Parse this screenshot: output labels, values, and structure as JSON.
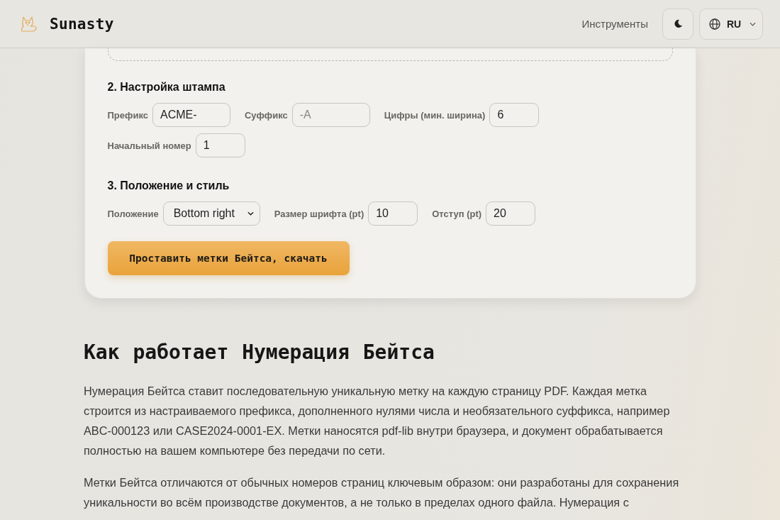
{
  "header": {
    "logo_text": "Sunasty",
    "nav_link": "Инструменты",
    "language": "RU"
  },
  "card": {
    "sections": [
      {
        "title": "2. Настройка штампа",
        "rows": [
          [
            {
              "label": "Префикс",
              "kind": "text",
              "value": "ACME-"
            },
            {
              "label": "Суффикс",
              "kind": "text",
              "placeholder": "-A"
            },
            {
              "label": "Цифры (мин. ширина)",
              "kind": "number",
              "value": "6"
            }
          ],
          [
            {
              "label": "Начальный номер",
              "kind": "number",
              "value": "1"
            }
          ]
        ]
      },
      {
        "title": "3. Положение и стиль",
        "rows": [
          [
            {
              "label": "Положение",
              "kind": "select",
              "value": "Bottom right"
            },
            {
              "label": "Размер шрифта (pt)",
              "kind": "number",
              "value": "10"
            },
            {
              "label": "Отступ (pt)",
              "kind": "number",
              "value": "20"
            }
          ]
        ]
      }
    ],
    "action_button": "Проставить метки Бейтса, скачать"
  },
  "article": {
    "heading": "Как работает Нумерация Бейтса",
    "paragraphs": [
      "Нумерация Бейтса ставит последовательную уникальную метку на каждую страницу PDF. Каждая метка строится из настраиваемого префикса, дополненного нулями числа и необязательного суффикса, например ABC-000123 или CASE2024-0001-EX. Метки наносятся pdf-lib внутри браузера, и документ обрабатывается полностью на вашем компьютере без передачи по сети.",
      "Метки Бейтса отличаются от обычных номеров страниц ключевым образом: они разработаны для сохранения уникальности во всём производстве документов, а не только в пределах одного файла. Нумерация с"
    ]
  }
}
